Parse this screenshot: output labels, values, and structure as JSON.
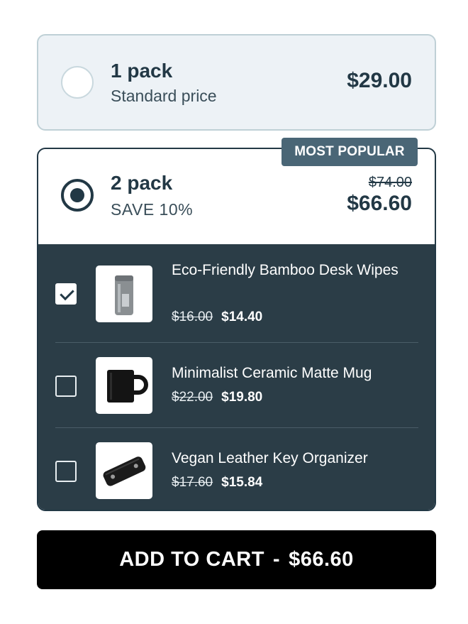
{
  "bundle": {
    "option1": {
      "title": "1 pack",
      "subtitle": "Standard price",
      "price": "$29.00",
      "selected": false
    },
    "option2": {
      "badge": "MOST POPULAR",
      "title": "2 pack",
      "subtitle": "SAVE 10%",
      "old_price": "$74.00",
      "price": "$66.60",
      "selected": true,
      "items": [
        {
          "name": "Eco-Friendly Bamboo Desk Wipes",
          "old_price": "$16.00",
          "price": "$14.40",
          "checked": true,
          "image_icon": "wipes-canister-icon"
        },
        {
          "name": "Minimalist Ceramic Matte Mug",
          "old_price": "$22.00",
          "price": "$19.80",
          "checked": false,
          "image_icon": "mug-icon"
        },
        {
          "name": "Vegan Leather Key Organizer",
          "old_price": "$17.60",
          "price": "$15.84",
          "checked": false,
          "image_icon": "key-organizer-icon"
        }
      ]
    }
  },
  "cta": {
    "label": "ADD TO CART",
    "separator": "-",
    "price": "$66.60"
  },
  "colors": {
    "accent": "#223845",
    "panel_dark": "#2b3d47",
    "badge": "#4a6676",
    "option_bg": "#edf2f6",
    "cta_bg": "#000000"
  }
}
